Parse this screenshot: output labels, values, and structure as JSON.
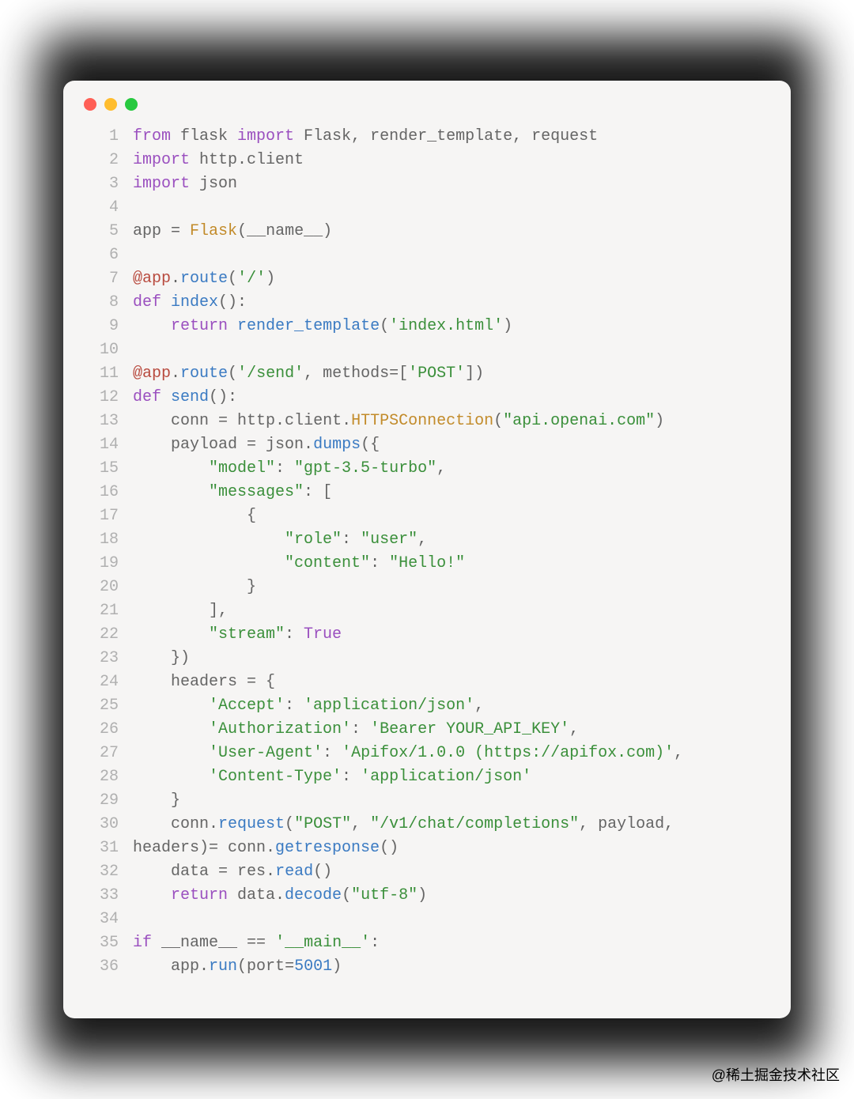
{
  "watermark": "@稀土掘金技术社区",
  "code": {
    "lines": [
      [
        {
          "c": "kw",
          "t": "from"
        },
        {
          "c": "id",
          "t": " flask "
        },
        {
          "c": "kw",
          "t": "import"
        },
        {
          "c": "id",
          "t": " Flask, render_template, request"
        }
      ],
      [
        {
          "c": "kw",
          "t": "import"
        },
        {
          "c": "id",
          "t": " http.client"
        }
      ],
      [
        {
          "c": "kw",
          "t": "import"
        },
        {
          "c": "id",
          "t": " json"
        }
      ],
      [],
      [
        {
          "c": "id",
          "t": "app "
        },
        {
          "c": "op",
          "t": "="
        },
        {
          "c": "id",
          "t": " "
        },
        {
          "c": "cls",
          "t": "Flask"
        },
        {
          "c": "op",
          "t": "("
        },
        {
          "c": "id",
          "t": "__name__"
        },
        {
          "c": "op",
          "t": ")"
        }
      ],
      [],
      [
        {
          "c": "def",
          "t": "@app"
        },
        {
          "c": "op",
          "t": "."
        },
        {
          "c": "fn",
          "t": "route"
        },
        {
          "c": "op",
          "t": "("
        },
        {
          "c": "str",
          "t": "'/'"
        },
        {
          "c": "op",
          "t": ")"
        }
      ],
      [
        {
          "c": "kw",
          "t": "def"
        },
        {
          "c": "id",
          "t": " "
        },
        {
          "c": "fn",
          "t": "index"
        },
        {
          "c": "op",
          "t": "():"
        }
      ],
      [
        {
          "c": "id",
          "t": "    "
        },
        {
          "c": "kw",
          "t": "return"
        },
        {
          "c": "id",
          "t": " "
        },
        {
          "c": "fn",
          "t": "render_template"
        },
        {
          "c": "op",
          "t": "("
        },
        {
          "c": "str",
          "t": "'index.html'"
        },
        {
          "c": "op",
          "t": ")"
        }
      ],
      [],
      [
        {
          "c": "def",
          "t": "@app"
        },
        {
          "c": "op",
          "t": "."
        },
        {
          "c": "fn",
          "t": "route"
        },
        {
          "c": "op",
          "t": "("
        },
        {
          "c": "str",
          "t": "'/send'"
        },
        {
          "c": "op",
          "t": ", "
        },
        {
          "c": "id",
          "t": "methods"
        },
        {
          "c": "op",
          "t": "=["
        },
        {
          "c": "str",
          "t": "'POST'"
        },
        {
          "c": "op",
          "t": "])"
        }
      ],
      [
        {
          "c": "kw",
          "t": "def"
        },
        {
          "c": "id",
          "t": " "
        },
        {
          "c": "fn",
          "t": "send"
        },
        {
          "c": "op",
          "t": "():"
        }
      ],
      [
        {
          "c": "id",
          "t": "    conn "
        },
        {
          "c": "op",
          "t": "="
        },
        {
          "c": "id",
          "t": " http.client."
        },
        {
          "c": "cls",
          "t": "HTTPSConnection"
        },
        {
          "c": "op",
          "t": "("
        },
        {
          "c": "str",
          "t": "\"api.openai.com\""
        },
        {
          "c": "op",
          "t": ")"
        }
      ],
      [
        {
          "c": "id",
          "t": "    payload "
        },
        {
          "c": "op",
          "t": "="
        },
        {
          "c": "id",
          "t": " json."
        },
        {
          "c": "fn",
          "t": "dumps"
        },
        {
          "c": "op",
          "t": "({"
        }
      ],
      [
        {
          "c": "id",
          "t": "        "
        },
        {
          "c": "str",
          "t": "\"model\""
        },
        {
          "c": "op",
          "t": ": "
        },
        {
          "c": "str",
          "t": "\"gpt-3.5-turbo\""
        },
        {
          "c": "op",
          "t": ","
        }
      ],
      [
        {
          "c": "id",
          "t": "        "
        },
        {
          "c": "str",
          "t": "\"messages\""
        },
        {
          "c": "op",
          "t": ": ["
        }
      ],
      [
        {
          "c": "id",
          "t": "            "
        },
        {
          "c": "op",
          "t": "{"
        }
      ],
      [
        {
          "c": "id",
          "t": "                "
        },
        {
          "c": "str",
          "t": "\"role\""
        },
        {
          "c": "op",
          "t": ": "
        },
        {
          "c": "str",
          "t": "\"user\""
        },
        {
          "c": "op",
          "t": ","
        }
      ],
      [
        {
          "c": "id",
          "t": "                "
        },
        {
          "c": "str",
          "t": "\"content\""
        },
        {
          "c": "op",
          "t": ": "
        },
        {
          "c": "str",
          "t": "\"Hello!\""
        }
      ],
      [
        {
          "c": "id",
          "t": "            "
        },
        {
          "c": "op",
          "t": "}"
        }
      ],
      [
        {
          "c": "id",
          "t": "        "
        },
        {
          "c": "op",
          "t": "],"
        }
      ],
      [
        {
          "c": "id",
          "t": "        "
        },
        {
          "c": "str",
          "t": "\"stream\""
        },
        {
          "c": "op",
          "t": ": "
        },
        {
          "c": "bool",
          "t": "True"
        }
      ],
      [
        {
          "c": "id",
          "t": "    "
        },
        {
          "c": "op",
          "t": "})"
        }
      ],
      [
        {
          "c": "id",
          "t": "    headers "
        },
        {
          "c": "op",
          "t": "= {"
        }
      ],
      [
        {
          "c": "id",
          "t": "        "
        },
        {
          "c": "str",
          "t": "'Accept'"
        },
        {
          "c": "op",
          "t": ": "
        },
        {
          "c": "str",
          "t": "'application/json'"
        },
        {
          "c": "op",
          "t": ","
        }
      ],
      [
        {
          "c": "id",
          "t": "        "
        },
        {
          "c": "str",
          "t": "'Authorization'"
        },
        {
          "c": "op",
          "t": ": "
        },
        {
          "c": "str",
          "t": "'Bearer YOUR_API_KEY'"
        },
        {
          "c": "op",
          "t": ","
        }
      ],
      [
        {
          "c": "id",
          "t": "        "
        },
        {
          "c": "str",
          "t": "'User-Agent'"
        },
        {
          "c": "op",
          "t": ": "
        },
        {
          "c": "str",
          "t": "'Apifox/1.0.0 (https://apifox.com)'"
        },
        {
          "c": "op",
          "t": ","
        }
      ],
      [
        {
          "c": "id",
          "t": "        "
        },
        {
          "c": "str",
          "t": "'Content-Type'"
        },
        {
          "c": "op",
          "t": ": "
        },
        {
          "c": "str",
          "t": "'application/json'"
        }
      ],
      [
        {
          "c": "id",
          "t": "    "
        },
        {
          "c": "op",
          "t": "}"
        }
      ],
      [
        {
          "c": "id",
          "t": "    conn."
        },
        {
          "c": "fn",
          "t": "request"
        },
        {
          "c": "op",
          "t": "("
        },
        {
          "c": "str",
          "t": "\"POST\""
        },
        {
          "c": "op",
          "t": ", "
        },
        {
          "c": "str",
          "t": "\"/v1/chat/completions\""
        },
        {
          "c": "op",
          "t": ", "
        },
        {
          "c": "id",
          "t": "payload"
        },
        {
          "c": "op",
          "t": ","
        }
      ],
      [
        {
          "c": "id",
          "t": "headers)= conn."
        },
        {
          "c": "fn",
          "t": "getresponse"
        },
        {
          "c": "op",
          "t": "()"
        }
      ],
      [
        {
          "c": "id",
          "t": "    data "
        },
        {
          "c": "op",
          "t": "="
        },
        {
          "c": "id",
          "t": " res."
        },
        {
          "c": "fn",
          "t": "read"
        },
        {
          "c": "op",
          "t": "()"
        }
      ],
      [
        {
          "c": "id",
          "t": "    "
        },
        {
          "c": "kw",
          "t": "return"
        },
        {
          "c": "id",
          "t": " data."
        },
        {
          "c": "fn",
          "t": "decode"
        },
        {
          "c": "op",
          "t": "("
        },
        {
          "c": "str",
          "t": "\"utf-8\""
        },
        {
          "c": "op",
          "t": ")"
        }
      ],
      [],
      [
        {
          "c": "kw",
          "t": "if"
        },
        {
          "c": "id",
          "t": " __name__ "
        },
        {
          "c": "op",
          "t": "=="
        },
        {
          "c": "id",
          "t": " "
        },
        {
          "c": "str",
          "t": "'__main__'"
        },
        {
          "c": "op",
          "t": ":"
        }
      ],
      [
        {
          "c": "id",
          "t": "    app."
        },
        {
          "c": "fn",
          "t": "run"
        },
        {
          "c": "op",
          "t": "("
        },
        {
          "c": "id",
          "t": "port"
        },
        {
          "c": "op",
          "t": "="
        },
        {
          "c": "num",
          "t": "5001"
        },
        {
          "c": "op",
          "t": ")"
        }
      ]
    ]
  }
}
